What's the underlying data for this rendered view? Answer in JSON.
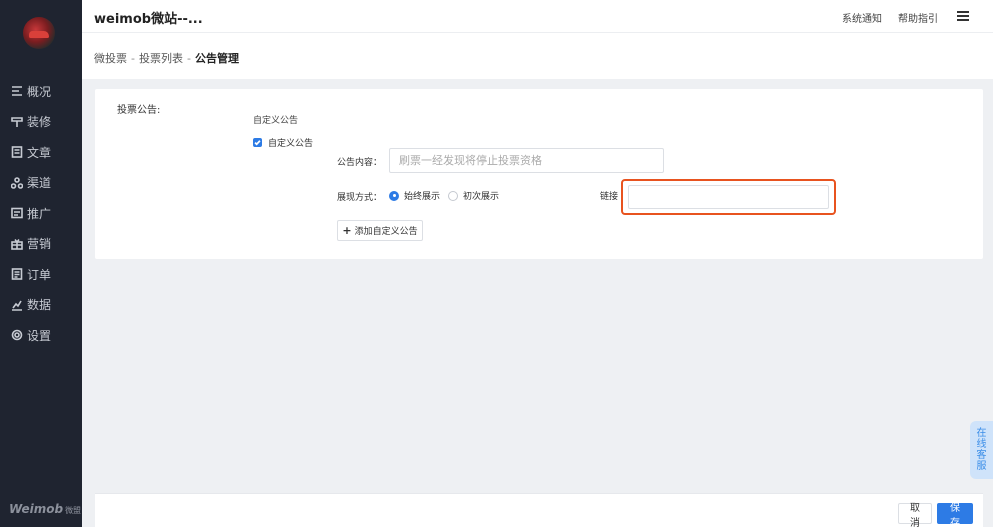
{
  "app": {
    "title": "weimob微站--..."
  },
  "topbar": {
    "notice": "系统通知",
    "help": "帮助指引"
  },
  "sidebar": {
    "items": [
      {
        "label": "概况",
        "icon": "overview-icon"
      },
      {
        "label": "装修",
        "icon": "decorate-icon"
      },
      {
        "label": "文章",
        "icon": "article-icon"
      },
      {
        "label": "渠道",
        "icon": "channel-icon"
      },
      {
        "label": "推广",
        "icon": "promote-icon"
      },
      {
        "label": "营销",
        "icon": "marketing-icon"
      },
      {
        "label": "订单",
        "icon": "order-icon"
      },
      {
        "label": "数据",
        "icon": "data-icon"
      },
      {
        "label": "设置",
        "icon": "settings-icon"
      }
    ],
    "logo": "Weimob",
    "logo_sub": "微盟"
  },
  "breadcrumb": {
    "part1": "微投票",
    "part2": "投票列表",
    "current": "公告管理",
    "sep": "-"
  },
  "form": {
    "section_label": "投票公告:",
    "sub_label": "自定义公告",
    "checkbox_label": "自定义公告",
    "checkbox_checked": true,
    "content_label": "公告内容：",
    "content_placeholder": "刷票一经发现将停止投票资格",
    "content_value": "",
    "display_label": "展现方式：",
    "radio_always": "始终展示",
    "radio_first": "初次展示",
    "radio_selected": "始终展示",
    "link_label": "链接",
    "link_value": "",
    "add_button": "添加自定义公告",
    "add_symbol": "+"
  },
  "service_tab": "在线客服",
  "footer": {
    "cancel": "取消",
    "save": "保存"
  },
  "colors": {
    "accent": "#2d7be5",
    "highlight": "#e8531f",
    "sidebar_bg": "#1f2430"
  }
}
